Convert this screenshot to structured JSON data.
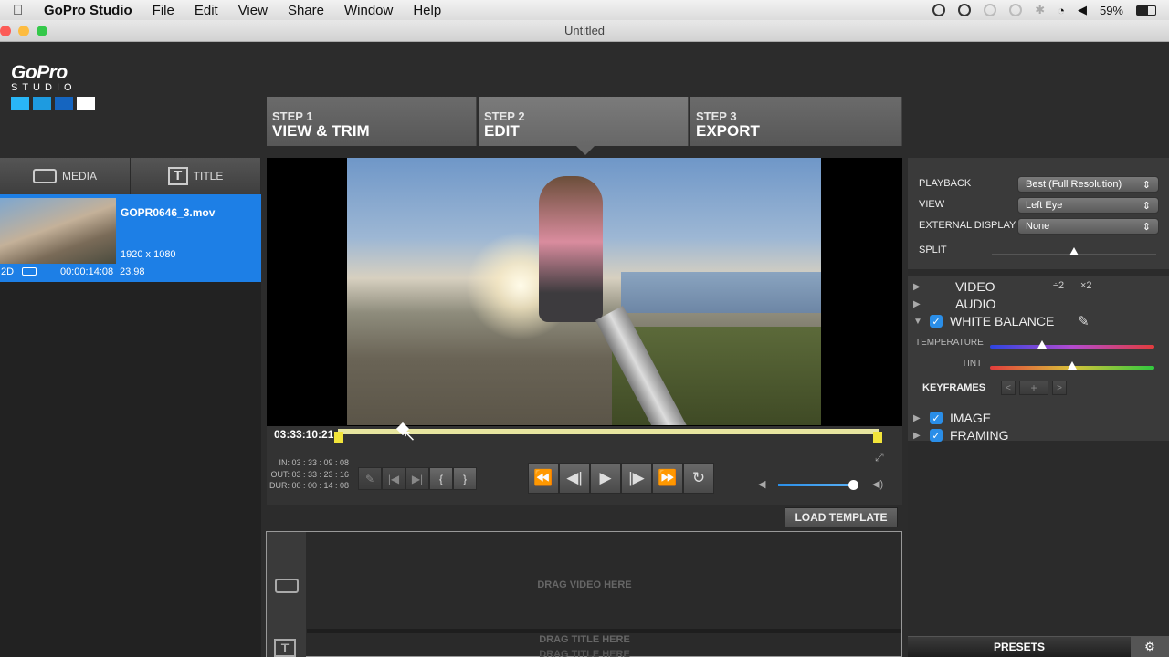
{
  "menubar": {
    "app_name": "GoPro Studio",
    "items": [
      "File",
      "Edit",
      "View",
      "Share",
      "Window",
      "Help"
    ],
    "battery": "59%"
  },
  "window": {
    "title": "Untitled"
  },
  "logo": {
    "brand": "GoPro",
    "sub": "STUDIO",
    "colors": [
      "#29b6f6",
      "#1e9be0",
      "#1565c0",
      "#ffffff"
    ]
  },
  "steps": [
    {
      "num": "STEP 1",
      "label": "VIEW & TRIM"
    },
    {
      "num": "STEP 2",
      "label": "EDIT"
    },
    {
      "num": "STEP 3",
      "label": "EXPORT"
    }
  ],
  "left": {
    "tabs": {
      "media": "MEDIA",
      "title": "TITLE"
    },
    "media_item": {
      "filename": "GOPR0646_3.mov",
      "resolution": "1920 x 1080",
      "mode": "2D",
      "duration": "00:00:14:08",
      "fps": "23.98"
    }
  },
  "player": {
    "timecode": "03:33:10:21",
    "in": "IN: 03 : 33 : 09 : 08",
    "out": "OUT: 03 : 33 : 23 : 16",
    "dur": "DUR: 00 : 00 : 14 : 08",
    "playhead_fraction": 0.12,
    "volume_fraction": 0.95
  },
  "template": {
    "load_label": "LOAD TEMPLATE",
    "drag_video": "DRAG VIDEO HERE",
    "drag_title": "DRAG TITLE HERE",
    "drag_title2": "DRAG TITLE HERE"
  },
  "right": {
    "playback_label": "PLAYBACK",
    "playback_value": "Best (Full Resolution)",
    "view_label": "VIEW",
    "view_value": "Left Eye",
    "external_label": "EXTERNAL DISPLAY",
    "external_value": "None",
    "split_label": "SPLIT",
    "sections": {
      "video": "VIDEO",
      "speed_half": "÷2",
      "speed_double": "×2",
      "audio": "AUDIO",
      "white_balance": "WHITE BALANCE",
      "temperature": "TEMPERATURE",
      "tint": "TINT",
      "keyframes": "KEYFRAMES",
      "image": "IMAGE",
      "framing": "FRAMING"
    },
    "presets": "PRESETS"
  }
}
